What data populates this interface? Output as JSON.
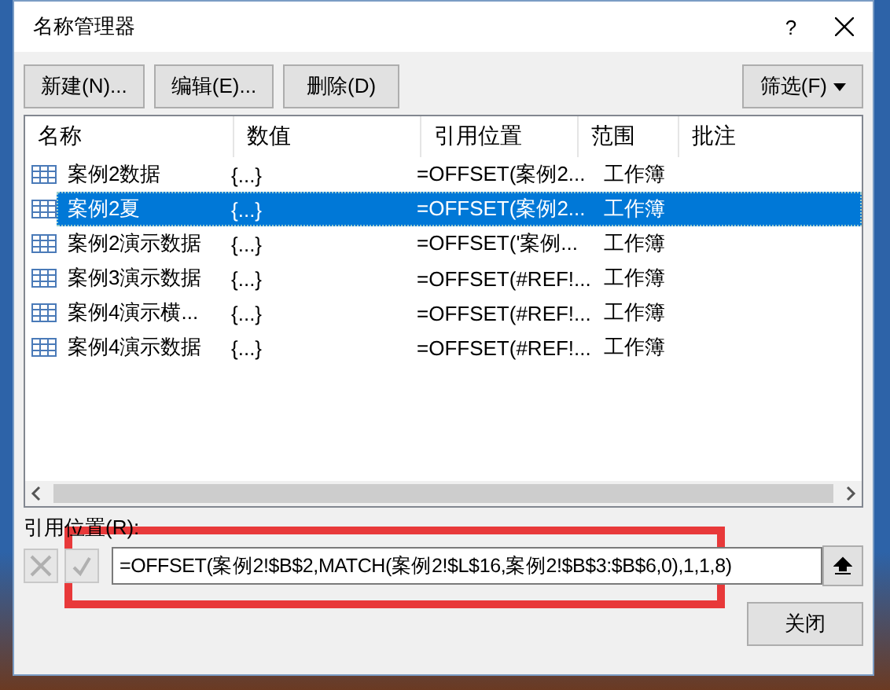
{
  "window": {
    "title": "名称管理器",
    "help": "?"
  },
  "toolbar": {
    "buttons": [
      "新建(N)...",
      "编辑(E)...",
      "删除(D)"
    ],
    "filter": "筛选(F)"
  },
  "table": {
    "columns": [
      "名称",
      "数值",
      "引用位置",
      "范围",
      "批注"
    ],
    "rows": [
      {
        "name": "案例2数据",
        "value": "{...}",
        "refers_to": "=OFFSET(案例2...",
        "scope": "工作簿",
        "selected": false
      },
      {
        "name": "案例2夏",
        "value": "{...}",
        "refers_to": "=OFFSET(案例2...",
        "scope": "工作簿",
        "selected": true
      },
      {
        "name": "案例2演示数据",
        "value": "{...}",
        "refers_to": "=OFFSET('案例...",
        "scope": "工作簿",
        "selected": false
      },
      {
        "name": "案例3演示数据",
        "value": "{...}",
        "refers_to": "=OFFSET(#REF!...",
        "scope": "工作簿",
        "selected": false
      },
      {
        "name": "案例4演示横...",
        "value": "{...}",
        "refers_to": "=OFFSET(#REF!...",
        "scope": "工作簿",
        "selected": false
      },
      {
        "name": "案例4演示数据",
        "value": "{...}",
        "refers_to": "=OFFSET(#REF!...",
        "scope": "工作簿",
        "selected": false
      }
    ]
  },
  "refers_to": {
    "label": "引用位置(R):",
    "value": "=OFFSET(案例2!$B$2,MATCH(案例2!$L$16,案例2!$B$3:$B$6,0),1,1,8)"
  },
  "close_button": "关闭"
}
